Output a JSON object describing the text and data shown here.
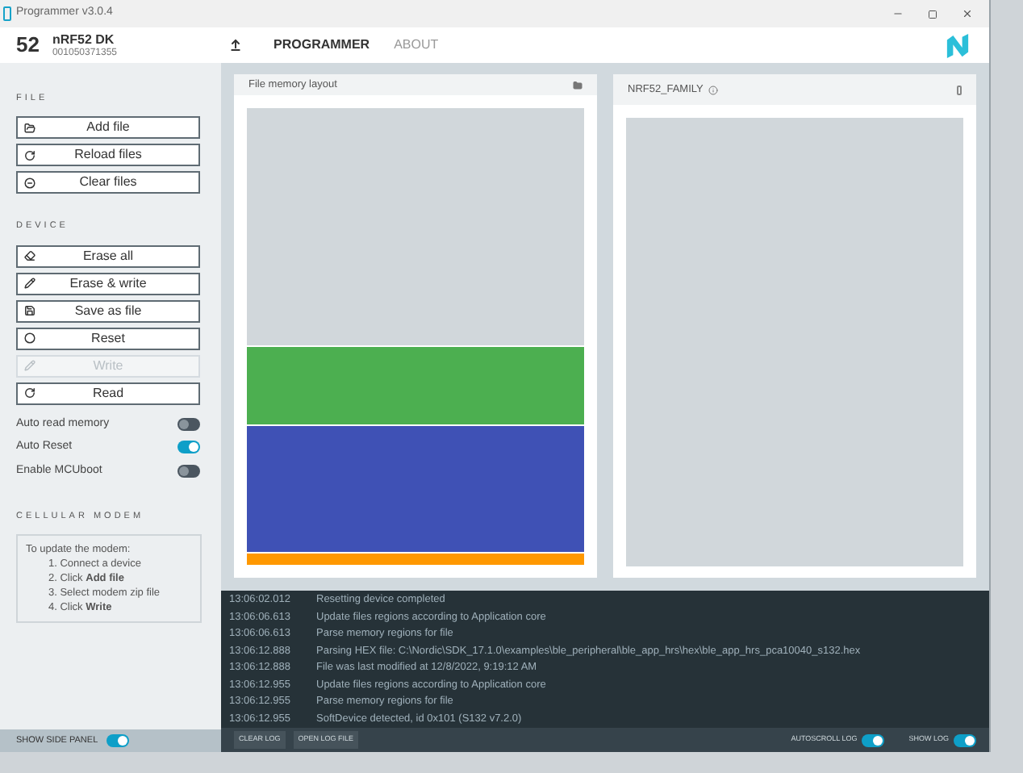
{
  "window": {
    "title": "Programmer v3.0.4"
  },
  "device": {
    "badge": "52",
    "name": "nRF52 DK",
    "serial": "001050371355"
  },
  "nav": [
    {
      "label": "PROGRAMMER",
      "selected": true
    },
    {
      "label": "ABOUT",
      "selected": false
    }
  ],
  "sidebar": {
    "file": {
      "heading": "FILE",
      "buttons": [
        {
          "label": "Add file",
          "disabled": false
        },
        {
          "label": "Reload files",
          "disabled": false
        },
        {
          "label": "Clear files",
          "disabled": false
        }
      ]
    },
    "device": {
      "heading": "DEVICE",
      "buttons": [
        {
          "label": "Erase all",
          "disabled": false
        },
        {
          "label": "Erase & write",
          "disabled": false
        },
        {
          "label": "Save as file",
          "disabled": false
        },
        {
          "label": "Reset",
          "disabled": false
        },
        {
          "label": "Write",
          "disabled": true
        },
        {
          "label": "Read",
          "disabled": false
        }
      ],
      "toggles": [
        {
          "label": "Auto read memory",
          "on": false
        },
        {
          "label": "Auto Reset",
          "on": true
        },
        {
          "label": "Enable MCUboot",
          "on": false
        }
      ]
    },
    "modem": {
      "heading": "CELLULAR MODEM",
      "intro": "To update the modem:",
      "steps": [
        "1. Connect a device",
        "2. Click **Add file**",
        "3. Select modem zip file",
        "4. Click **Write**"
      ]
    },
    "show_side_panel": {
      "label": "SHOW SIDE PANEL",
      "on": true
    }
  },
  "file_panel": {
    "title": "File memory layout",
    "regions": [
      {
        "color": "#d1d7db"
      },
      {
        "color": "#4caf50"
      },
      {
        "color": "#3f51b5"
      },
      {
        "color": "#ff9800"
      }
    ]
  },
  "device_panel": {
    "title": "NRF52_FAMILY"
  },
  "log": {
    "entries": [
      {
        "time": "13:06:02.012",
        "message": "Resetting device completed"
      },
      {
        "time": "13:06:06.613",
        "message": "Update files regions according to Application core"
      },
      {
        "time": "13:06:06.613",
        "message": "Parse memory regions for file"
      },
      {
        "time": "13:06:12.888",
        "message": "Parsing HEX file: C:\\Nordic\\SDK_17.1.0\\examples\\ble_peripheral\\ble_app_hrs\\hex\\ble_app_hrs_pca10040_s132.hex"
      },
      {
        "time": "13:06:12.888",
        "message": "File was last modified at 12/8/2022, 9:19:12 AM"
      },
      {
        "time": "13:06:12.955",
        "message": "Update files regions according to Application core"
      },
      {
        "time": "13:06:12.955",
        "message": "Parse memory regions for file"
      },
      {
        "time": "13:06:12.955",
        "message": "SoftDevice detected, id 0x101 (S132 v7.2.0)"
      }
    ],
    "buttons": [
      "CLEAR LOG",
      "OPEN LOG FILE"
    ],
    "toggles": [
      {
        "label": "AUTOSCROLL LOG",
        "on": true
      },
      {
        "label": "SHOW LOG",
        "on": true
      }
    ]
  }
}
